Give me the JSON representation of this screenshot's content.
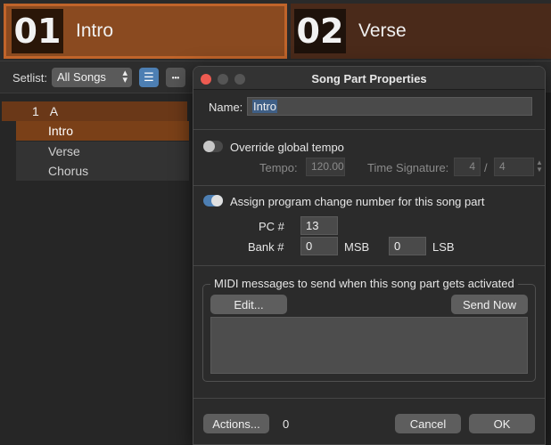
{
  "tiles": [
    {
      "number": "01",
      "name": "Intro"
    },
    {
      "number": "02",
      "name": "Verse"
    }
  ],
  "toolbar": {
    "setlist_label": "Setlist:",
    "setlist_value": "All Songs",
    "sort_icon_glyph": "☰",
    "more_glyph": "•••"
  },
  "songlist": {
    "song": {
      "number": "1",
      "name": "A"
    },
    "parts": [
      "Intro",
      "Verse",
      "Chorus"
    ]
  },
  "dialog": {
    "title": "Song Part Properties",
    "name_label": "Name:",
    "name_value": "Intro",
    "override_tempo_label": "Override global tempo",
    "override_tempo_on": false,
    "tempo_label": "Tempo:",
    "tempo_value": "120.00",
    "time_sig_label": "Time Signature:",
    "time_sig_numerator": "4",
    "time_sig_slash": "/",
    "time_sig_denominator": "4",
    "assign_pc_label": "Assign program change number for this song part",
    "assign_pc_on": true,
    "pc_label": "PC #",
    "pc_value": "13",
    "bank_label": "Bank #",
    "msb_value": "0",
    "msb_label": "MSB",
    "lsb_value": "0",
    "lsb_label": "LSB",
    "midi_group_title": "MIDI messages to send when this song part gets activated",
    "edit_button": "Edit...",
    "send_now_button": "Send Now",
    "actions_button": "Actions...",
    "actions_count": "0",
    "cancel_button": "Cancel",
    "ok_button": "OK"
  },
  "colors": {
    "accent_blue": "#4d7fb3",
    "active_orange": "#8a4a20",
    "close_red": "#ee5b51"
  }
}
